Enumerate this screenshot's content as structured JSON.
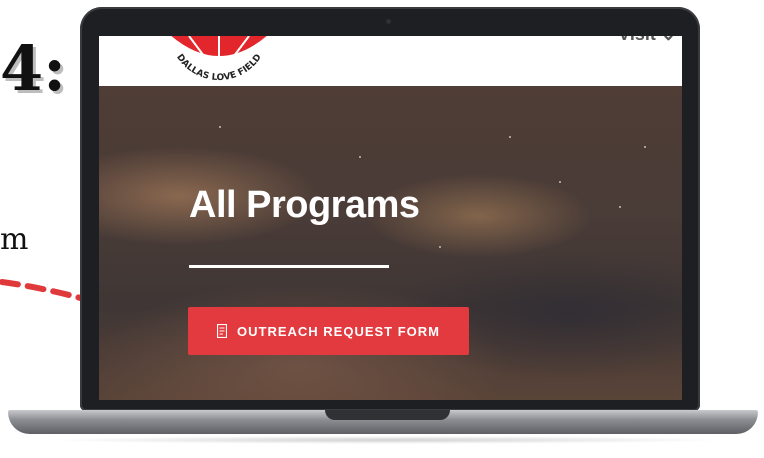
{
  "slide": {
    "step_number": "4:",
    "fragment_text": "m"
  },
  "site": {
    "logo_text": "DALLAS LOVE FIELD",
    "nav_item": "Visit"
  },
  "hero": {
    "title": "All Programs",
    "cta_label": "OUTREACH REQUEST FORM"
  },
  "icons": {
    "cta_icon": "form-icon",
    "pointer": "dashed-arrow-icon"
  },
  "colors": {
    "cta": "#e23a3e",
    "arrow": "#e0393c",
    "logo_red": "#e3262b"
  }
}
